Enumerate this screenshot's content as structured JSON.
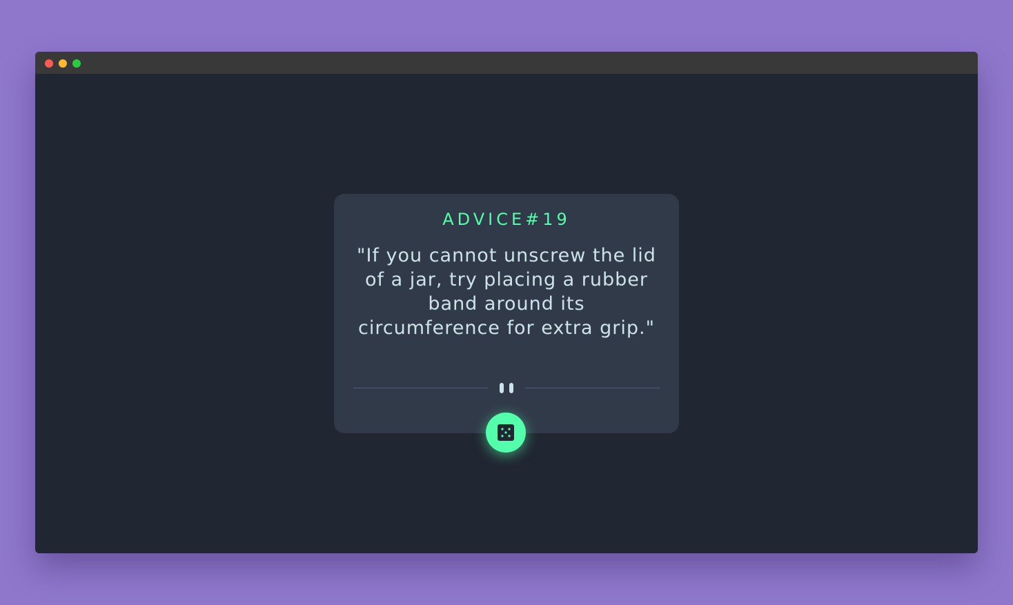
{
  "window": {
    "controls": [
      "close",
      "minimize",
      "maximize"
    ]
  },
  "card": {
    "advice_id": "ADVICE#19",
    "quote": "\"If you cannot unscrew the lid of a jar, try placing a rubber band around its circumference for extra grip.\"",
    "divider_icon": "pause-icon"
  },
  "dice_button": {
    "icon": "dice-icon"
  },
  "colors": {
    "page_background": "#8f78cc",
    "window_background": "#202632",
    "titlebar": "#393939",
    "card": "#313a49",
    "accent": "#53ffaa",
    "quote_text": "#cee3e9",
    "divider": "#4f5d74",
    "close": "#fd5a52",
    "minimize": "#fdba2e",
    "maximize": "#2acc3f"
  }
}
